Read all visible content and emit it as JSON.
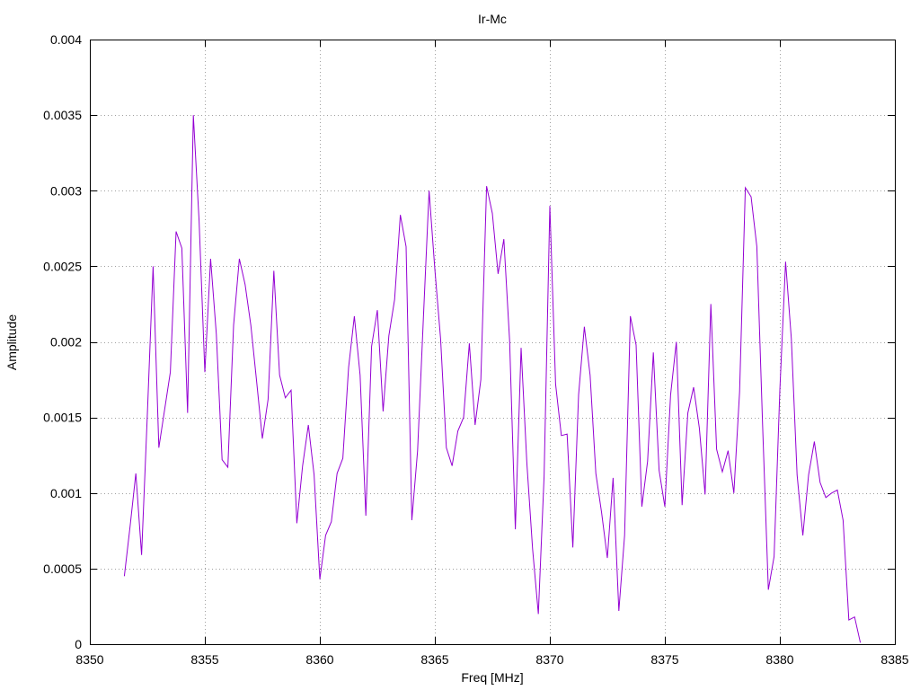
{
  "chart_data": {
    "type": "line",
    "title": "Ir-Mc",
    "xlabel": "Freq [MHz]",
    "ylabel": "Amplitude",
    "xlim": [
      8350,
      8385
    ],
    "ylim": [
      0,
      0.004
    ],
    "x_ticks": [
      8350,
      8355,
      8360,
      8365,
      8370,
      8375,
      8380,
      8385
    ],
    "y_ticks": [
      0,
      0.0005,
      0.001,
      0.0015,
      0.002,
      0.0025,
      0.003,
      0.0035,
      0.004
    ],
    "x_tick_labels": [
      "8350",
      "8355",
      "8360",
      "8365",
      "8370",
      "8375",
      "8380",
      "8385"
    ],
    "y_tick_labels": [
      "0",
      "0.0005",
      "0.001",
      "0.0015",
      "0.002",
      "0.0025",
      "0.003",
      "0.0035",
      "0.004"
    ],
    "grid": true,
    "line_color": "#9400d3",
    "series": [
      {
        "x": [
          8351.5,
          8351.75,
          8352.0,
          8352.25,
          8352.5,
          8352.75,
          8353.0,
          8353.25,
          8353.5,
          8353.75,
          8354.0,
          8354.25,
          8354.5,
          8354.75,
          8355.0,
          8355.25,
          8355.5,
          8355.75,
          8356.0,
          8356.25,
          8356.5,
          8356.75,
          8357.0,
          8357.25,
          8357.5,
          8357.75,
          8358.0,
          8358.25,
          8358.5,
          8358.75,
          8359.0,
          8359.25,
          8359.5,
          8359.75,
          8360.0,
          8360.25,
          8360.5,
          8360.75,
          8361.0,
          8361.25,
          8361.5,
          8361.75,
          8362.0,
          8362.25,
          8362.5,
          8362.75,
          8363.0,
          8363.25,
          8363.5,
          8363.75,
          8364.0,
          8364.25,
          8364.5,
          8364.75,
          8365.0,
          8365.25,
          8365.5,
          8365.75,
          8366.0,
          8366.25,
          8366.5,
          8366.75,
          8367.0,
          8367.25,
          8367.5,
          8367.75,
          8368.0,
          8368.25,
          8368.5,
          8368.75,
          8369.0,
          8369.25,
          8369.5,
          8369.75,
          8370.0,
          8370.25,
          8370.5,
          8370.75,
          8371.0,
          8371.25,
          8371.5,
          8371.75,
          8372.0,
          8372.25,
          8372.5,
          8372.75,
          8373.0,
          8373.25,
          8373.5,
          8373.75,
          8374.0,
          8374.25,
          8374.5,
          8374.75,
          8375.0,
          8375.25,
          8375.5,
          8375.75,
          8376.0,
          8376.25,
          8376.5,
          8376.75,
          8377.0,
          8377.25,
          8377.5,
          8377.75,
          8378.0,
          8378.25,
          8378.5,
          8378.75,
          8379.0,
          8379.25,
          8379.5,
          8379.75,
          8380.0,
          8380.25,
          8380.5,
          8380.75,
          8381.0,
          8381.25,
          8381.5,
          8381.75,
          8382.0,
          8382.25,
          8382.5,
          8382.75,
          8383.0,
          8383.25,
          8383.5
        ],
        "values": [
          0.00045,
          0.00078,
          0.00113,
          0.00059,
          0.00152,
          0.0025,
          0.0013,
          0.00155,
          0.0018,
          0.00273,
          0.00262,
          0.00153,
          0.0035,
          0.0028,
          0.0018,
          0.00255,
          0.00205,
          0.00122,
          0.00117,
          0.00211,
          0.00255,
          0.00238,
          0.00211,
          0.00174,
          0.00136,
          0.00162,
          0.00247,
          0.00178,
          0.00163,
          0.00168,
          0.0008,
          0.00118,
          0.00145,
          0.00112,
          0.00043,
          0.00072,
          0.00081,
          0.00113,
          0.00123,
          0.00183,
          0.00217,
          0.00178,
          0.00085,
          0.00197,
          0.00221,
          0.00154,
          0.00204,
          0.00228,
          0.00284,
          0.00263,
          0.00082,
          0.00128,
          0.00215,
          0.003,
          0.00248,
          0.00202,
          0.0013,
          0.00118,
          0.00141,
          0.0015,
          0.00199,
          0.00145,
          0.00175,
          0.00303,
          0.00285,
          0.00245,
          0.00268,
          0.00201,
          0.00076,
          0.00196,
          0.0012,
          0.00063,
          0.0002,
          0.00111,
          0.0029,
          0.00172,
          0.00138,
          0.00139,
          0.00064,
          0.00165,
          0.0021,
          0.00178,
          0.00113,
          0.00087,
          0.00057,
          0.0011,
          0.00022,
          0.00072,
          0.00217,
          0.00198,
          0.00091,
          0.00121,
          0.00193,
          0.00115,
          0.00091,
          0.00165,
          0.002,
          0.00092,
          0.00153,
          0.0017,
          0.00143,
          0.00099,
          0.00225,
          0.00129,
          0.00114,
          0.00128,
          0.001,
          0.00167,
          0.00302,
          0.00296,
          0.00263,
          0.00145,
          0.00036,
          0.00058,
          0.00168,
          0.00253,
          0.00202,
          0.00112,
          0.00072,
          0.00112,
          0.00134,
          0.00107,
          0.00097,
          0.001,
          0.00102,
          0.00082,
          0.00016,
          0.00018,
          1e-05
        ]
      }
    ]
  }
}
